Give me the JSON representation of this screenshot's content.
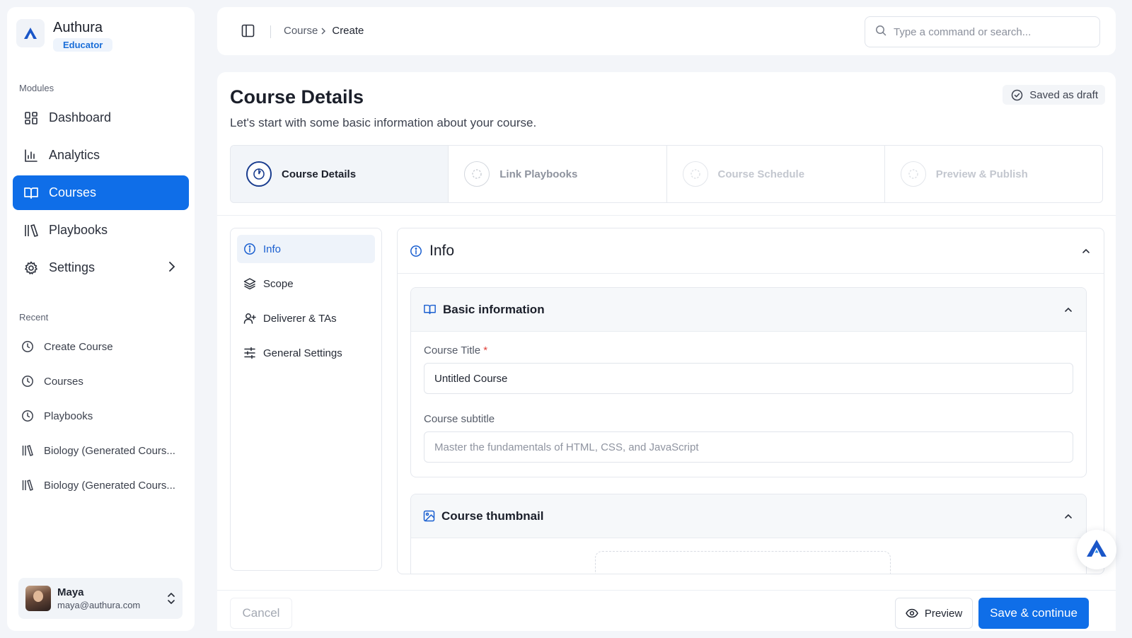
{
  "brand": {
    "name": "Authura",
    "role": "Educator"
  },
  "sidebar": {
    "modules_label": "Modules",
    "items": [
      {
        "label": "Dashboard",
        "icon": "dashboard-icon"
      },
      {
        "label": "Analytics",
        "icon": "bar-chart-icon"
      },
      {
        "label": "Courses",
        "icon": "book-open-icon",
        "active": true
      },
      {
        "label": "Playbooks",
        "icon": "library-icon"
      },
      {
        "label": "Settings",
        "icon": "gear-icon"
      }
    ],
    "recent_label": "Recent",
    "recent": [
      {
        "label": "Create Course",
        "icon": "clock-icon"
      },
      {
        "label": "Courses",
        "icon": "clock-icon"
      },
      {
        "label": "Playbooks",
        "icon": "clock-icon"
      },
      {
        "label": "Biology (Generated Cours...",
        "icon": "library-icon"
      },
      {
        "label": "Biology (Generated Cours...",
        "icon": "library-icon"
      }
    ]
  },
  "user": {
    "name": "Maya",
    "email": "maya@authura.com"
  },
  "topbar": {
    "breadcrumb": [
      "Course",
      "Create"
    ],
    "search_placeholder": "Type a command or search..."
  },
  "page": {
    "title": "Course Details",
    "subtitle": "Let's start with some basic information about your course.",
    "draft_status": "Saved as draft"
  },
  "steps": [
    {
      "label": "Course Details",
      "state": "active"
    },
    {
      "label": "Link Playbooks",
      "state": "pending"
    },
    {
      "label": "Course Schedule",
      "state": "pending"
    },
    {
      "label": "Preview & Publish",
      "state": "pending"
    }
  ],
  "subnav": [
    {
      "label": "Info",
      "icon": "info-icon",
      "active": true
    },
    {
      "label": "Scope",
      "icon": "layers-icon"
    },
    {
      "label": "Deliverer & TAs",
      "icon": "user-plus-icon"
    },
    {
      "label": "General Settings",
      "icon": "sliders-icon"
    }
  ],
  "content": {
    "header": "Info",
    "basic_info": {
      "title": "Basic information",
      "course_title_label": "Course Title",
      "required_mark": "*",
      "course_title_value": "Untitled Course",
      "course_subtitle_label": "Course subtitle",
      "course_subtitle_placeholder": "Master the fundamentals of HTML, CSS, and JavaScript"
    },
    "thumbnail": {
      "title": "Course thumbnail"
    }
  },
  "footer": {
    "cancel": "Cancel",
    "preview": "Preview",
    "save": "Save & continue"
  },
  "colors": {
    "accent": "#0f6ee8",
    "brand_dark": "#1a3d8f"
  }
}
